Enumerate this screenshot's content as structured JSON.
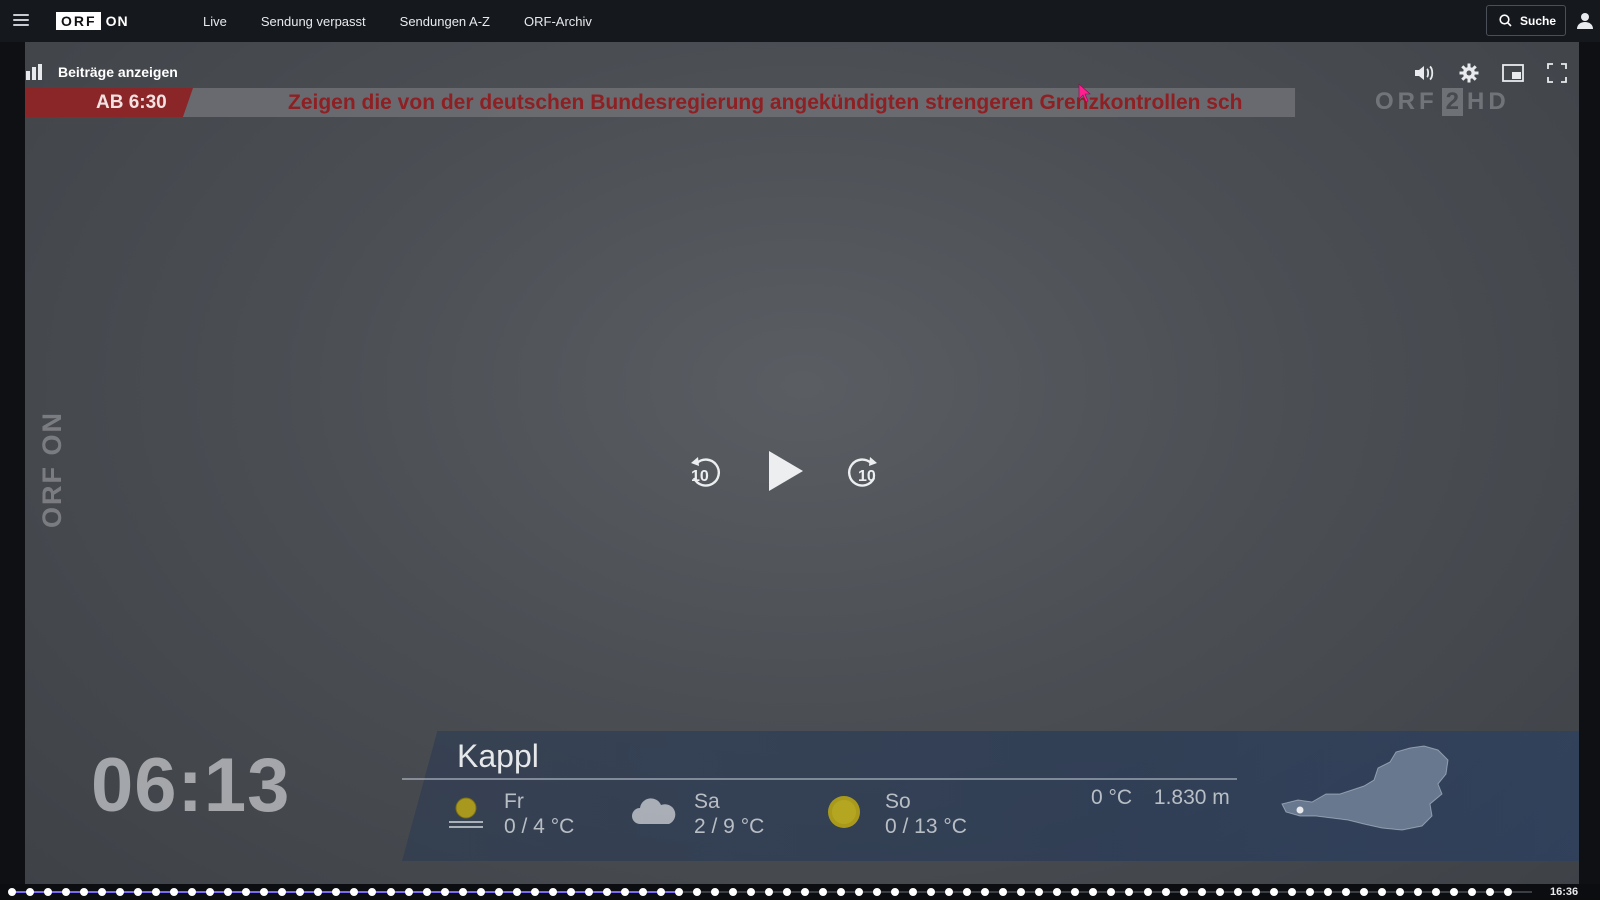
{
  "topbar": {
    "logo_box": "ORF",
    "logo_on": "ON",
    "nav": [
      "Live",
      "Sendung verpasst",
      "Sendungen A-Z",
      "ORF-Archiv"
    ],
    "search_label": "Suche"
  },
  "player": {
    "beitraege_label": "Beiträge anzeigen",
    "ticker_tag": "AB 6:30",
    "ticker_text": "Zeigen die von der deutschen Bundesregierung angekündigten strengeren Grenzkontrollen sch",
    "channel_logo": {
      "pre": "ORF",
      "num": "2",
      "post": "HD"
    },
    "watermark": "ORF ON",
    "rewind_label": "10",
    "forward_label": "10",
    "controls": [
      "volume-icon",
      "settings-icon",
      "picture-in-picture-icon",
      "fullscreen-icon"
    ]
  },
  "weather": {
    "clock": "06:13",
    "city": "Kappl",
    "days": [
      {
        "day": "Fr",
        "temps": "0 / 4 °C",
        "icon": "fog-sun-icon"
      },
      {
        "day": "Sa",
        "temps": "2 / 9 °C",
        "icon": "cloud-icon"
      },
      {
        "day": "So",
        "temps": "0 / 13 °C",
        "icon": "sun-icon"
      }
    ],
    "current_temp": "0 °C",
    "altitude": "1.830 m"
  },
  "timeline": {
    "progress": 0.44,
    "time_end": "16:36"
  },
  "colors": {
    "accent": "#7a6cf2",
    "ticker_red": "#8e1f22",
    "topbar_bg": "#15181d"
  }
}
